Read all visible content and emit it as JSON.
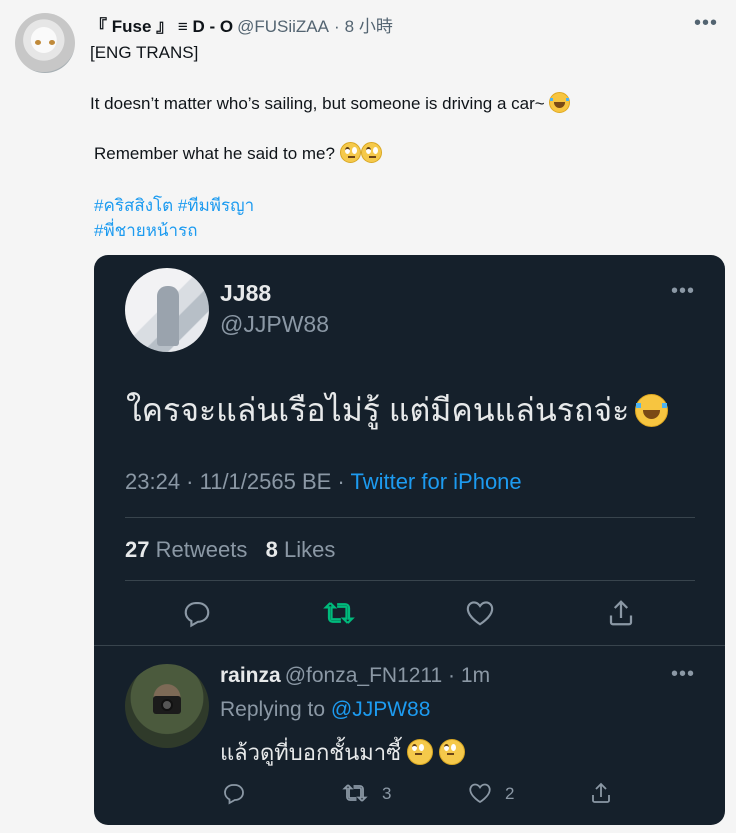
{
  "outer_tweet": {
    "display_name": "『 Fuse 』 ≡ D - O",
    "handle": "@FUSiiZAA",
    "time": "8 小時",
    "more": "•••",
    "line1": "[ENG TRANS]",
    "line2": "It doesn’t matter who’s sailing, but someone is driving a car~",
    "line3": "Remember what he said to me?",
    "hashtags": [
      "#คริสสิงโต",
      "#ทีมพีรญา",
      "#พี่ชายหน้ารถ"
    ]
  },
  "quoted": {
    "name": "JJ88",
    "handle": "@JJPW88",
    "more": "•••",
    "text": "ใครจะแล่นเรือไม่รู้ แต่มีคนแล่นรถจ่ะ",
    "meta_time": "23:24 · 11/1/2565 BE · ",
    "meta_source": "Twitter for iPhone",
    "retweets_count": "27",
    "retweets_label": "Retweets",
    "likes_count": "8",
    "likes_label": "Likes"
  },
  "reply": {
    "name": "rainza",
    "handle": "@fonza_FN1211 · 1m",
    "replying_label": "Replying to",
    "replying_to": "@JJPW88",
    "text": "แล้วดูที่บอกชั้นมาซี้",
    "more": "•••",
    "retweet_count": "3",
    "like_count": "2"
  },
  "colors": {
    "accent_blue": "#1d9bf0",
    "retweet_green": "#00ba7c",
    "card_bg": "#15202b"
  }
}
